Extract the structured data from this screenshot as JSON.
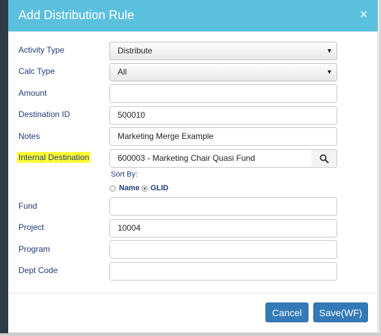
{
  "modal": {
    "title": "Add Distribution Rule",
    "close_symbol": "×"
  },
  "form": {
    "activity_type": {
      "label": "Activity Type",
      "value": "Distribute"
    },
    "calc_type": {
      "label": "Calc Type",
      "value": "All"
    },
    "amount": {
      "label": "Amount",
      "value": ""
    },
    "destination_id": {
      "label": "Destination ID",
      "value": "500010"
    },
    "notes": {
      "label": "Notes",
      "value": "Marketing Merge Example"
    },
    "internal_destination": {
      "label": "Internal Destination",
      "value": "600003 - Marketing Chair Quasi Fund"
    },
    "sort_by": {
      "label": "Sort By:",
      "options": [
        {
          "label": "Name",
          "checked": false
        },
        {
          "label": "GLID",
          "checked": true
        }
      ]
    },
    "fund": {
      "label": "Fund",
      "value": ""
    },
    "project": {
      "label": "Project",
      "value": "10004"
    },
    "program": {
      "label": "Program",
      "value": ""
    },
    "dept_code": {
      "label": "Dept Code",
      "value": ""
    }
  },
  "footer": {
    "cancel_label": "Cancel",
    "save_label": "Save(WF)"
  },
  "colors": {
    "header": "#5bc0de",
    "primary_button": "#337ab7",
    "label_text": "#1f3a7a",
    "highlight": "#ffff33"
  },
  "icons": {
    "dropdown": "caret-down-icon",
    "search": "search-icon",
    "close": "close-icon"
  }
}
